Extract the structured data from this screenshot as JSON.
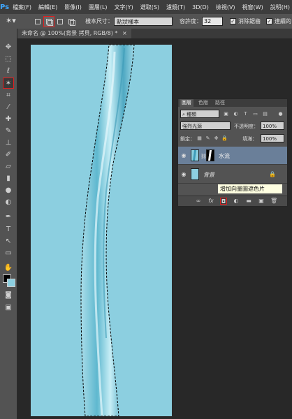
{
  "app": {
    "logo": "Ps"
  },
  "menu": [
    "檔案(F)",
    "編輯(E)",
    "影像(I)",
    "圖層(L)",
    "文字(Y)",
    "選取(S)",
    "濾鏡(T)",
    "3D(D)",
    "檢視(V)",
    "視窗(W)",
    "說明(H)"
  ],
  "options": {
    "sample_size_label": "樣本尺寸：",
    "sample_size_value": "點狀樣本",
    "tolerance_label": "容許度：",
    "tolerance_value": "32",
    "antialias_label": "消除鋸齒",
    "contiguous_label": "連續的"
  },
  "document_tab": {
    "title": "未命名 @ 100%(背景 拷貝, RGB/8) *",
    "close": "×"
  },
  "layers_panel": {
    "tabs": [
      "圖層",
      "色版",
      "路徑"
    ],
    "filter_value": "種類",
    "blend_mode": "強烈光源",
    "opacity_label": "不透明度：",
    "opacity_value": "100%",
    "lock_label": "鎖定：",
    "fill_label": "填滿：",
    "fill_value": "100%",
    "layers": [
      {
        "name": "水流",
        "selected": true,
        "thumb_color": "#8ccfe0"
      },
      {
        "name": "背景",
        "selected": false,
        "thumb_color": "#8ccfe0",
        "locked": true
      }
    ]
  },
  "tooltip": {
    "text": "增加向量圖遮色片"
  },
  "colors": {
    "canvas_bg": "#8ccfe0",
    "highlight": "#e02020"
  }
}
